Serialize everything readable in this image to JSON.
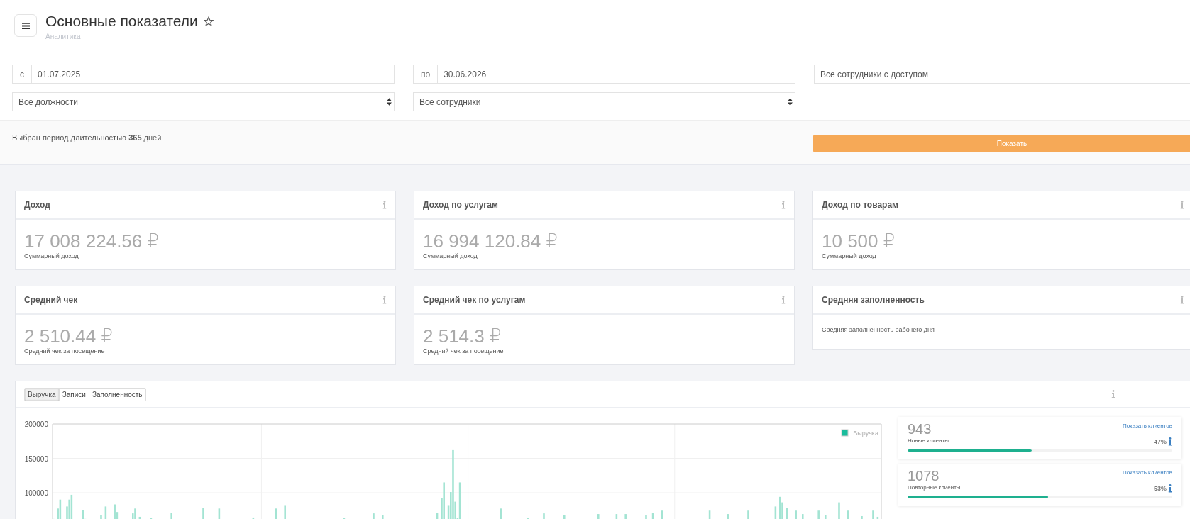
{
  "header": {
    "title": "Основные показатели",
    "breadcrumb": "Аналитика",
    "favorite": false
  },
  "filters": [
    {
      "kind": "date",
      "prefix": "с",
      "value": "01.07.2025"
    },
    {
      "kind": "date",
      "prefix": "по",
      "value": "30.06.2026"
    },
    {
      "kind": "select",
      "value": "Все сотрудники с доступом"
    },
    {
      "kind": "select",
      "value": "Все должности"
    },
    {
      "kind": "select",
      "value": "Все сотрудники"
    }
  ],
  "period": {
    "text": "Выбран период длительностью **365** дней",
    "button": "Показать"
  },
  "metrics": [
    {
      "title": "Доход",
      "value": "17 008 224.56 ₽",
      "caption": "Суммарный доход"
    },
    {
      "title": "Доход по услугам",
      "value": "16 994 120.84 ₽",
      "caption": "Суммарный доход"
    },
    {
      "title": "Доход по товарам",
      "value": "10 500 ₽",
      "caption": "Суммарный доход"
    },
    {
      "title": "Средний чек",
      "value": "2 510.44 ₽",
      "caption": "Средний чек за посещение"
    },
    {
      "title": "Средний чек по услугам",
      "value": "2 514.3 ₽",
      "caption": "Средний чек за посещение"
    },
    {
      "title": "Средняя заполненность",
      "caption": "Средняя заполненность рабочего дня"
    }
  ],
  "chart_panel": {
    "tabs": [
      {
        "label": "Выручка",
        "selected": true
      },
      {
        "label": "Записи",
        "selected": false
      },
      {
        "label": "Заполненность",
        "selected": false
      }
    ],
    "chart": {
      "y_labels": [
        "200000",
        "150000",
        "100000"
      ],
      "legend": "Выручка"
    },
    "client_stats": [
      {
        "count": "943",
        "label": "Новые клиенты",
        "link": "Показать клиентов",
        "percent": "47%",
        "level": 0.47
      },
      {
        "count": "1078",
        "label": "Повторные клиенты",
        "link": "Показать клиентов",
        "percent": "53%",
        "level": 0.53
      }
    ]
  }
}
